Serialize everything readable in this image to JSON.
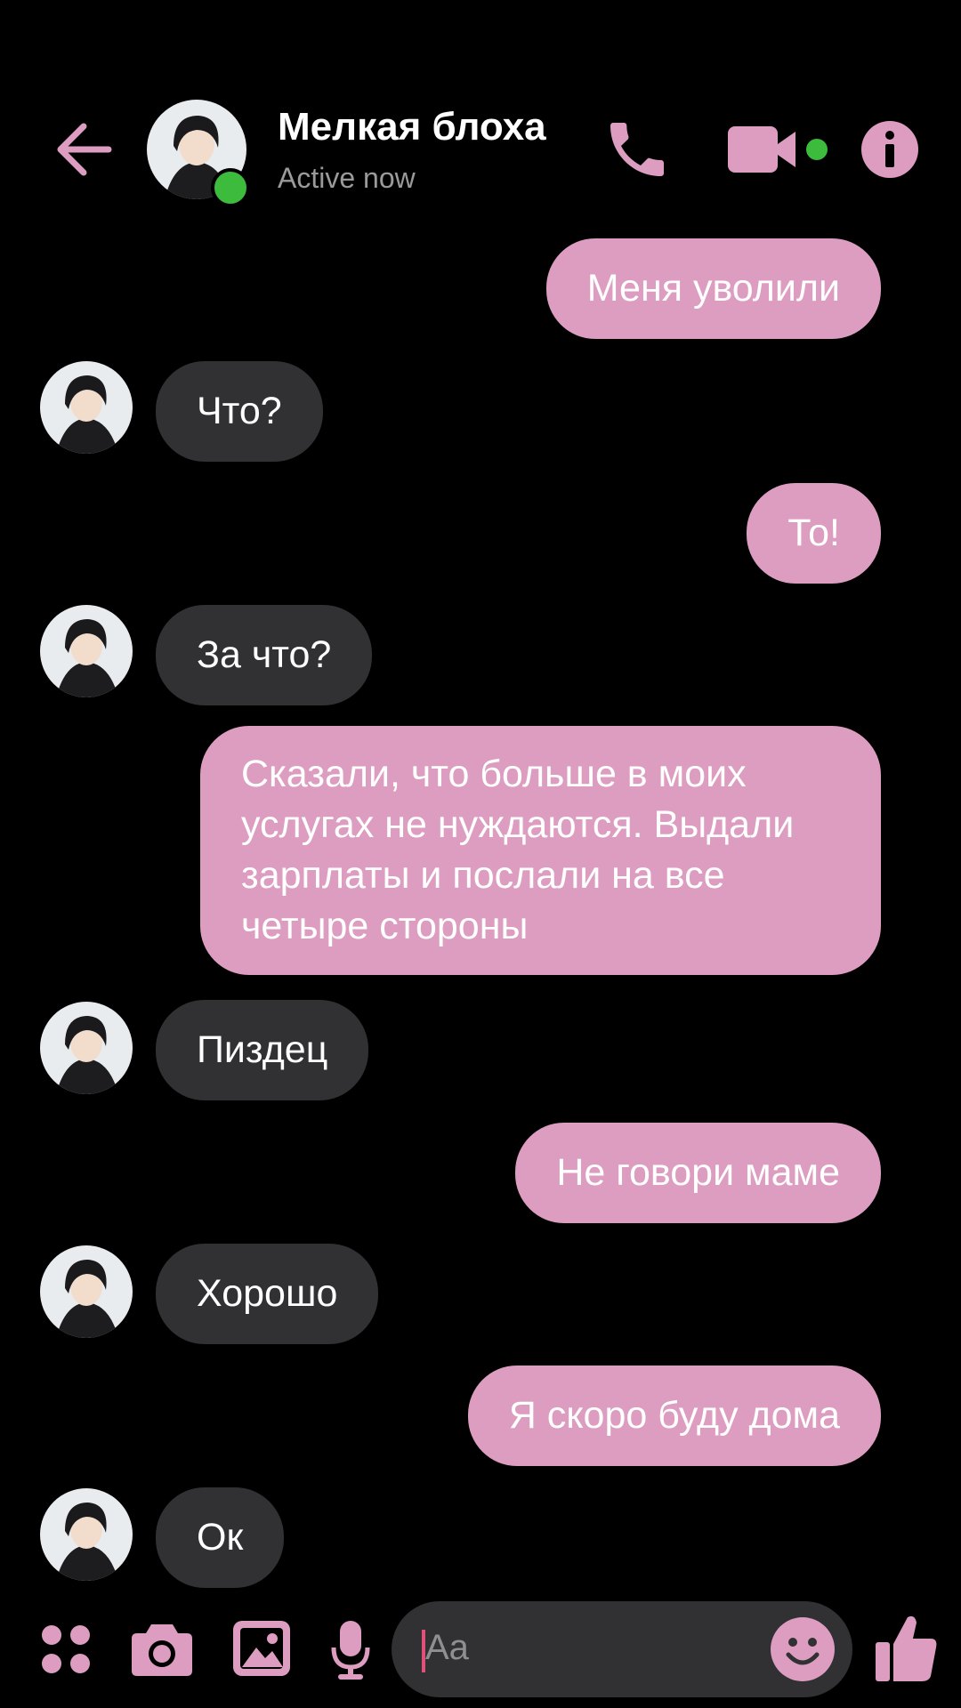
{
  "header": {
    "title": "Мелкая блоха",
    "status": "Active now"
  },
  "messages": [
    {
      "side": "out",
      "text": "Меня уволили"
    },
    {
      "side": "in",
      "text": "Что?"
    },
    {
      "side": "out",
      "text": "То!"
    },
    {
      "side": "in",
      "text": "За что?"
    },
    {
      "side": "out",
      "text": "Сказали, что больше в моих услугах не нуждаются. Выдали зарплаты и послали на все четыре стороны"
    },
    {
      "side": "in",
      "text": "Пиздец"
    },
    {
      "side": "out",
      "text": "Не говори маме"
    },
    {
      "side": "in",
      "text": "Хорошо"
    },
    {
      "side": "out",
      "text": "Я скоро буду дома"
    },
    {
      "side": "in",
      "text": "Ок"
    }
  ],
  "composer": {
    "placeholder": "Aa"
  },
  "colors": {
    "accent": "#dc9dc0",
    "incoming_bubble": "#313033",
    "online": "#3dbb3d",
    "background": "#000000"
  },
  "icons": [
    "back-arrow-icon",
    "phone-icon",
    "video-camera-icon",
    "info-icon",
    "apps-grid-icon",
    "camera-icon",
    "gallery-icon",
    "microphone-icon",
    "emoji-icon",
    "thumbs-up-icon"
  ]
}
